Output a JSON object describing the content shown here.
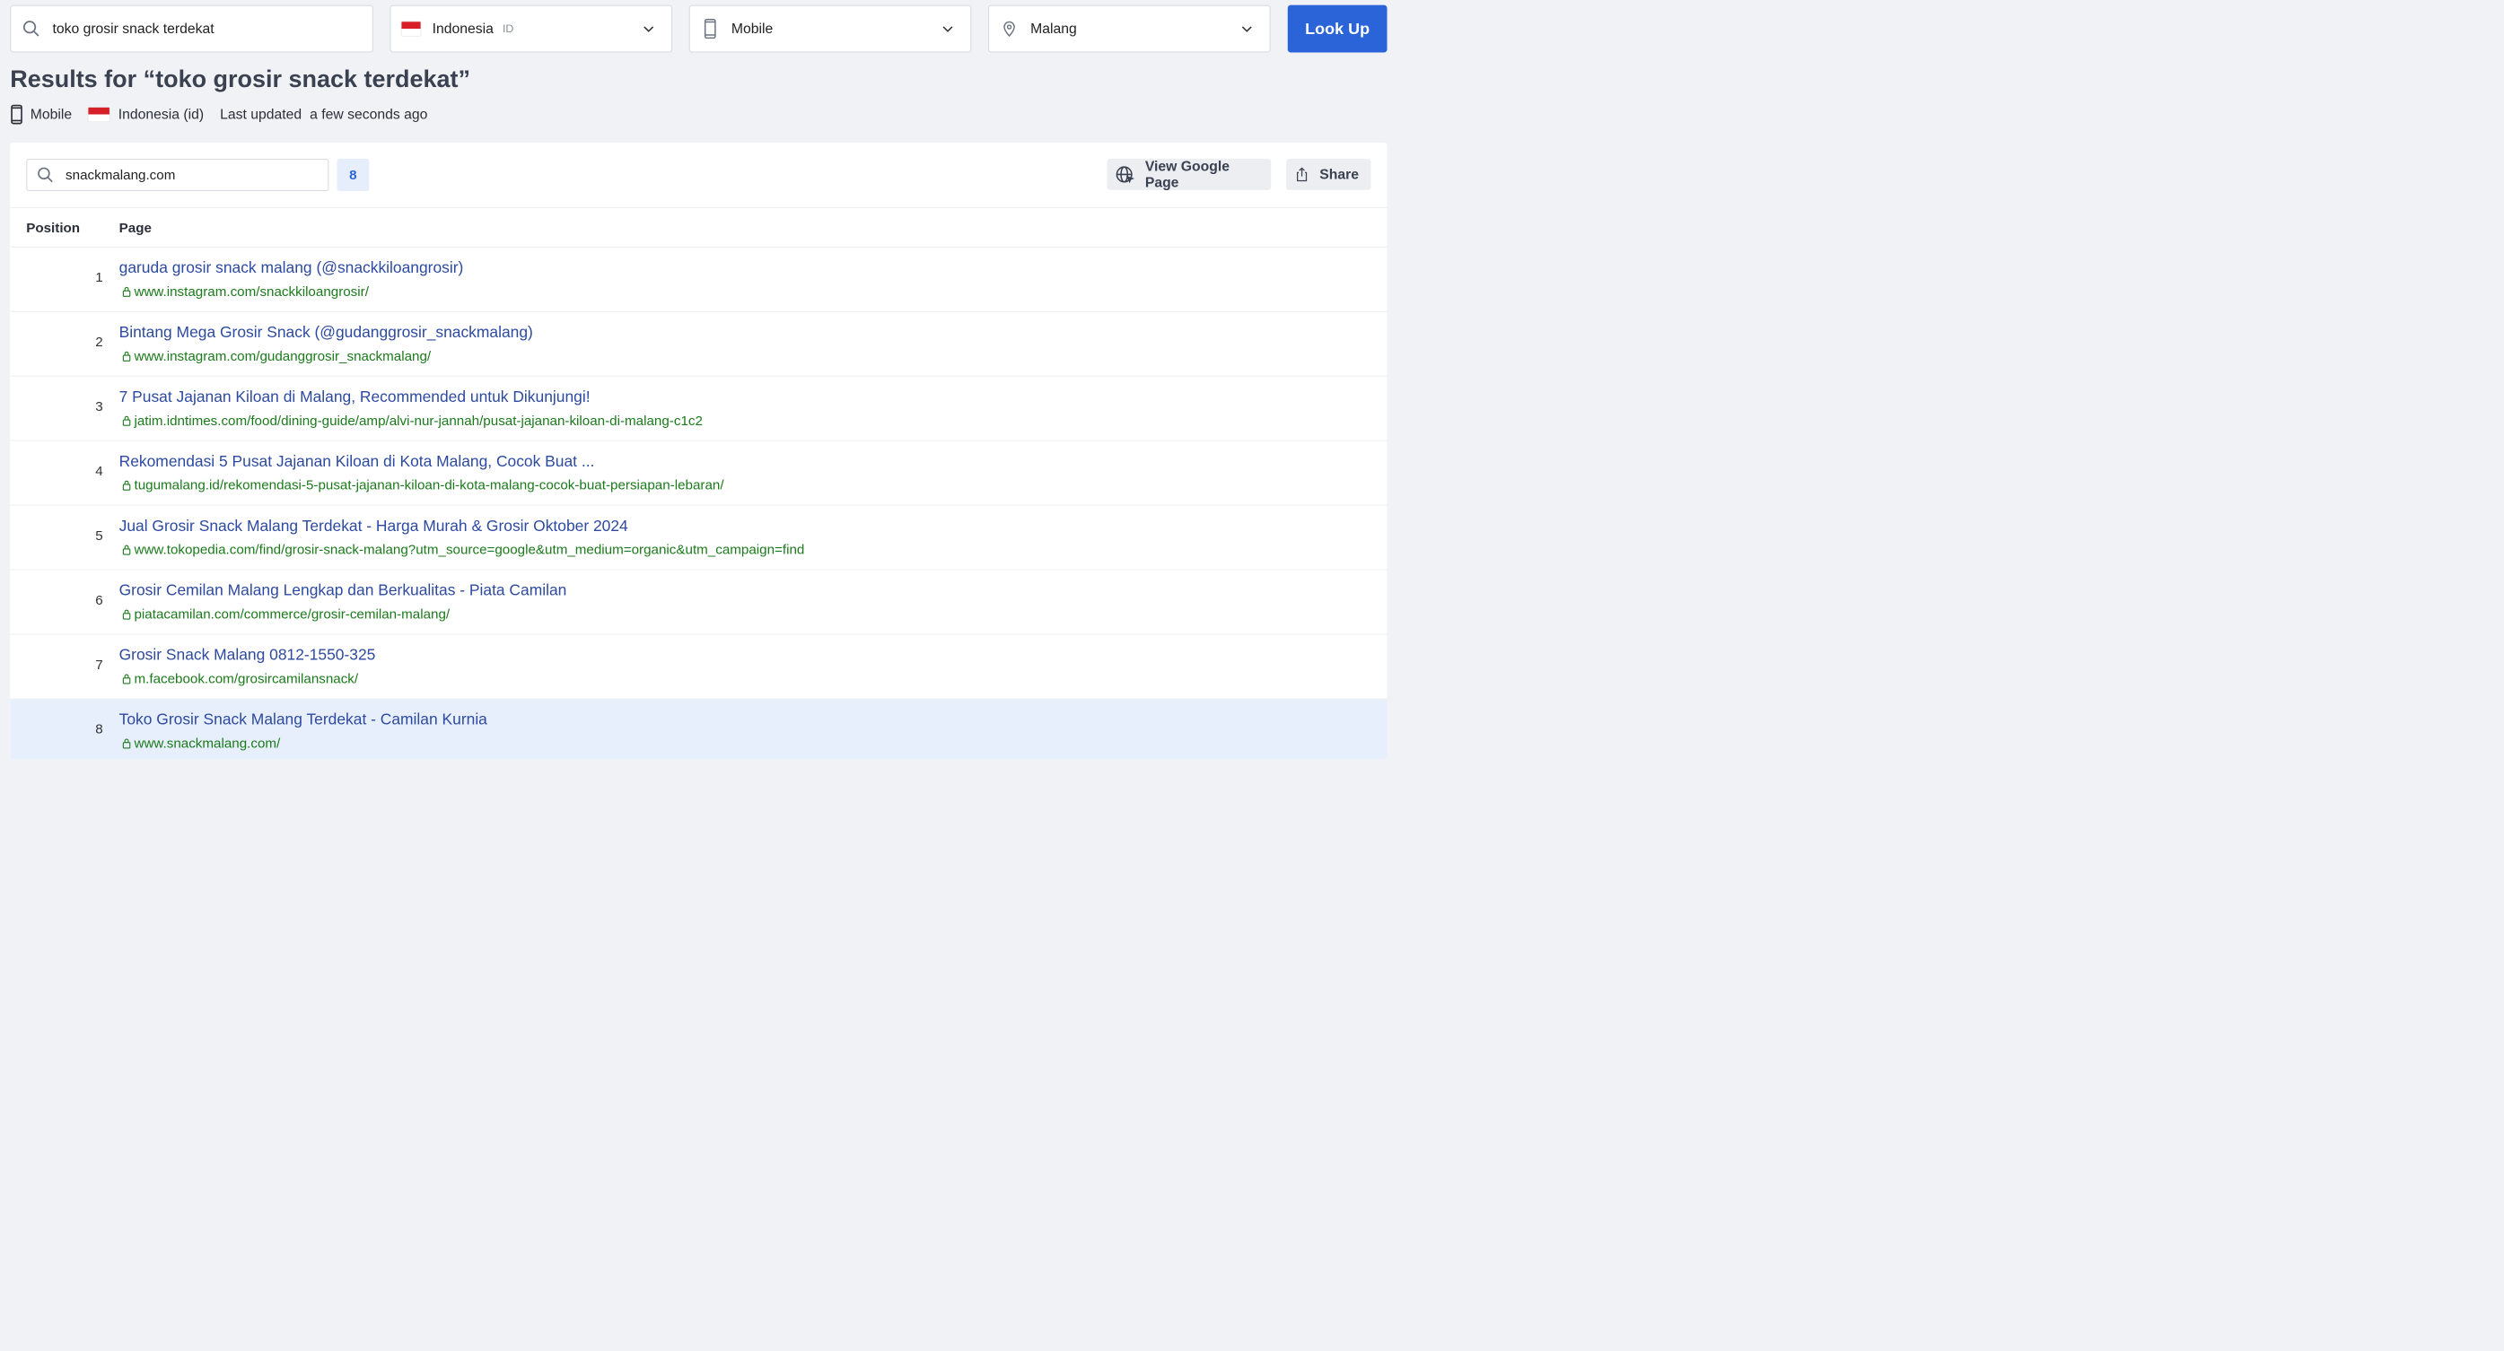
{
  "search": {
    "query": "toko grosir snack terdekat",
    "country": "Indonesia",
    "country_code": "ID",
    "device": "Mobile",
    "location": "Malang",
    "lookup_label": "Look Up"
  },
  "results_header": {
    "title": "Results for “toko grosir snack terdekat”",
    "device": "Mobile",
    "country": "Indonesia (id)",
    "last_updated_label": "Last updated",
    "last_updated_value": "a few seconds ago"
  },
  "toolbar": {
    "filter_value": "snackmalang.com",
    "match_count": "8",
    "view_google_label": "View Google Page",
    "share_label": "Share"
  },
  "table": {
    "col_position": "Position",
    "col_page": "Page",
    "rows": [
      {
        "position": "1",
        "title": "garuda grosir snack malang (@snackkiloangrosir)",
        "url": "www.instagram.com/snackkiloangrosir/"
      },
      {
        "position": "2",
        "title": "Bintang Mega Grosir Snack (@gudanggrosir_snackmalang)",
        "url": "www.instagram.com/gudanggrosir_snackmalang/"
      },
      {
        "position": "3",
        "title": "7 Pusat Jajanan Kiloan di Malang, Recommended untuk Dikunjungi!",
        "url": "jatim.idntimes.com/food/dining-guide/amp/alvi-nur-jannah/pusat-jajanan-kiloan-di-malang-c1c2"
      },
      {
        "position": "4",
        "title": "Rekomendasi 5 Pusat Jajanan Kiloan di Kota Malang, Cocok Buat ...",
        "url": "tugumalang.id/rekomendasi-5-pusat-jajanan-kiloan-di-kota-malang-cocok-buat-persiapan-lebaran/"
      },
      {
        "position": "5",
        "title": "Jual Grosir Snack Malang Terdekat - Harga Murah & Grosir Oktober 2024",
        "url": "www.tokopedia.com/find/grosir-snack-malang?utm_source=google&utm_medium=organic&utm_campaign=find"
      },
      {
        "position": "6",
        "title": "Grosir Cemilan Malang Lengkap dan Berkualitas - Piata Camilan",
        "url": "piatacamilan.com/commerce/grosir-cemilan-malang/"
      },
      {
        "position": "7",
        "title": "Grosir Snack Malang 0812-1550-325",
        "url": "m.facebook.com/grosircamilansnack/"
      },
      {
        "position": "8",
        "title": "Toko Grosir Snack Malang Terdekat - Camilan Kurnia",
        "url": "www.snackmalang.com/",
        "highlighted": true
      }
    ]
  },
  "colors": {
    "accent": "#2b63d8",
    "link": "#2d4aa0",
    "url": "#1b7a1b",
    "highlight_row": "#e7effd"
  }
}
